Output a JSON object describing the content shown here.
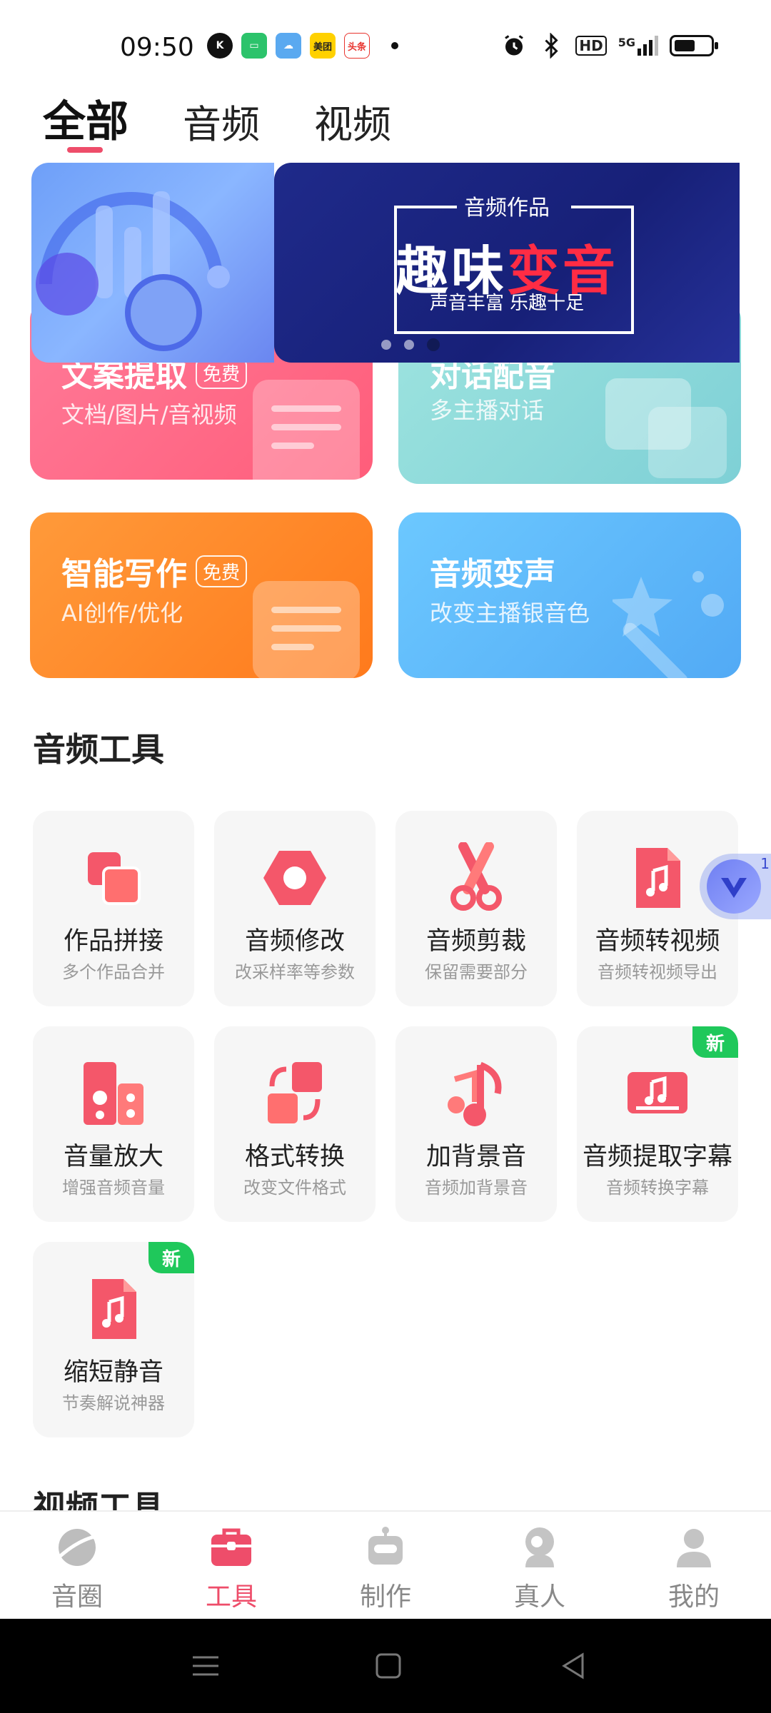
{
  "status_bar": {
    "time": "09:50",
    "notification_apps": [
      "K",
      "msg",
      "cloud",
      "美团",
      "头条"
    ],
    "network": "5G",
    "hd_label": "HD"
  },
  "top_tabs": [
    {
      "label": "全部",
      "active": true
    },
    {
      "label": "音频",
      "active": false
    },
    {
      "label": "视频",
      "active": false
    }
  ],
  "banner": {
    "top_text": "音频作品",
    "title_white": "趣味",
    "title_red": "变音",
    "subtitle": "声音丰富 乐趣十足",
    "page_count": 3,
    "active_page": 3
  },
  "feature_cards": [
    {
      "title": "文案提取",
      "badge": "免费",
      "subtitle": "文档/图片/音视频",
      "color": "#ff6c8c"
    },
    {
      "title": "对话配音",
      "badge": "",
      "subtitle": "多主播对话",
      "color": "#8fdad8"
    },
    {
      "title": "智能写作",
      "badge": "免费",
      "subtitle": "AI创作/优化",
      "color": "#ff8a2b"
    },
    {
      "title": "音频变声",
      "badge": "",
      "subtitle": "改变主播银音色",
      "color": "#5fb7ff"
    }
  ],
  "audio_section": {
    "title": "音频工具",
    "tools": [
      {
        "name": "作品拼接",
        "desc": "多个作品合并",
        "icon": "merge-icon",
        "is_new": false
      },
      {
        "name": "音频修改",
        "desc": "改采样率等参数",
        "icon": "hexagon-settings-icon",
        "is_new": false
      },
      {
        "name": "音频剪裁",
        "desc": "保留需要部分",
        "icon": "scissors-icon",
        "is_new": false
      },
      {
        "name": "音频转视频",
        "desc": "音频转视频导出",
        "icon": "music-file-icon",
        "is_new": false
      },
      {
        "name": "音量放大",
        "desc": "增强音频音量",
        "icon": "speaker-icon",
        "is_new": false
      },
      {
        "name": "格式转换",
        "desc": "改变文件格式",
        "icon": "convert-icon",
        "is_new": false
      },
      {
        "name": "加背景音",
        "desc": "音频加背景音",
        "icon": "music-note-icon",
        "is_new": false
      },
      {
        "name": "音频提取字幕",
        "desc": "音频转换字幕",
        "icon": "subtitle-music-icon",
        "is_new": true
      },
      {
        "name": "缩短静音",
        "desc": "节奏解说神器",
        "icon": "music-file-icon",
        "is_new": true
      }
    ],
    "new_badge": "新"
  },
  "video_section": {
    "title": "视频工具"
  },
  "floating_widget": {
    "count": "1"
  },
  "bottom_nav": [
    {
      "label": "音圈",
      "icon": "planet-icon",
      "active": false
    },
    {
      "label": "工具",
      "icon": "toolbox-icon",
      "active": true
    },
    {
      "label": "制作",
      "icon": "robot-icon",
      "active": false
    },
    {
      "label": "真人",
      "icon": "person-headset-icon",
      "active": false
    },
    {
      "label": "我的",
      "icon": "user-icon",
      "active": false
    }
  ],
  "colors": {
    "accent": "#ee4d6a",
    "tool_icon": "#f4576a",
    "new_badge": "#1fc85b"
  }
}
